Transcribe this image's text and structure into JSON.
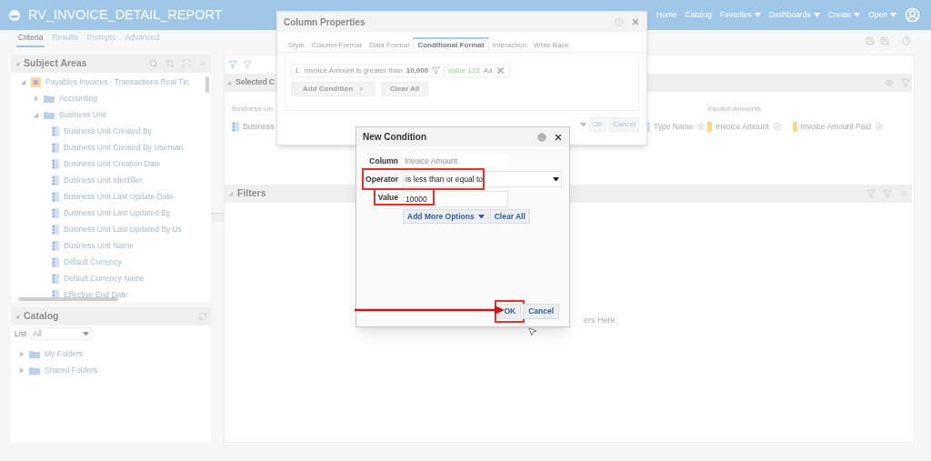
{
  "header": {
    "title": "RV_INVOICE_DETAIL_REPORT",
    "nav": [
      {
        "label": "Home",
        "dropdown": false
      },
      {
        "label": "Catalog",
        "dropdown": false
      },
      {
        "label": "Favorites",
        "dropdown": true
      },
      {
        "label": "Dashboards",
        "dropdown": true
      },
      {
        "label": "Create",
        "dropdown": true
      },
      {
        "label": "Open",
        "dropdown": true
      }
    ]
  },
  "tabs": [
    {
      "label": "Criteria",
      "selected": true
    },
    {
      "label": "Results",
      "selected": false
    },
    {
      "label": "Prompts",
      "selected": false
    },
    {
      "label": "Advanced",
      "selected": false
    }
  ],
  "subject_areas": {
    "title": "Subject Areas",
    "tree": [
      {
        "label": "Payables Invoices - Transactions Real Tin",
        "kind": "subject",
        "expanded": true,
        "children": [
          {
            "label": "Accounting",
            "kind": "folder",
            "expanded": false
          },
          {
            "label": "Business Unit",
            "kind": "folder",
            "expanded": true,
            "children": [
              {
                "label": "Business Unit Created By",
                "kind": "column"
              },
              {
                "label": "Business Unit Created By Usernan",
                "kind": "column"
              },
              {
                "label": "Business Unit Creation Date",
                "kind": "column"
              },
              {
                "label": "Business Unit Identifier",
                "kind": "column"
              },
              {
                "label": "Business Unit Last Update Date",
                "kind": "column"
              },
              {
                "label": "Business Unit Last Updated By",
                "kind": "column"
              },
              {
                "label": "Business Unit Last Updated By Us",
                "kind": "column"
              },
              {
                "label": "Business Unit Name",
                "kind": "column"
              },
              {
                "label": "Default Currency",
                "kind": "column"
              },
              {
                "label": "Default Currency Name",
                "kind": "column"
              },
              {
                "label": "Effective End Date",
                "kind": "column"
              }
            ]
          }
        ]
      }
    ]
  },
  "catalog": {
    "title": "Catalog",
    "list_label": "List",
    "list_value": "All",
    "tree": [
      {
        "label": "My Folders",
        "kind": "folder",
        "expanded": false
      },
      {
        "label": "Shared Folders",
        "kind": "folder",
        "expanded": false
      }
    ]
  },
  "selected_columns": {
    "title": "Selected C",
    "groups": [
      {
        "heading": "Business Un",
        "columns": [
          {
            "label": "Business",
            "kind": "attribute"
          }
        ]
      },
      {
        "columns": [
          {
            "label": "Type Name",
            "kind": "attribute"
          }
        ]
      },
      {
        "heading": "Invoice Amounts",
        "columns": [
          {
            "label": "Invoice Amount",
            "kind": "measure"
          },
          {
            "label": "Invoice Amount Paid",
            "kind": "measure"
          }
        ]
      }
    ]
  },
  "filters": {
    "title": "Filters",
    "drop_hint": "ers Here"
  },
  "column_properties": {
    "title": "Column Properties",
    "tabs": [
      {
        "label": "Style",
        "selected": false
      },
      {
        "label": "Column Format",
        "selected": false
      },
      {
        "label": "Data Format",
        "selected": false
      },
      {
        "label": "Conditional Format",
        "selected": true
      },
      {
        "label": "Interaction",
        "selected": false
      },
      {
        "label": "Write Back",
        "selected": false
      }
    ],
    "conditions": [
      {
        "number": "1.",
        "text": "Invoice Amount is greater than",
        "value": "10,000",
        "format_preview": "Value 123",
        "font_sample": "Aa"
      }
    ],
    "buttons": [
      {
        "label": "Add Condition",
        "kind": "menu"
      },
      {
        "label": "Clear All",
        "kind": "plain"
      }
    ],
    "footer_buttons": [
      "OK",
      "Cancel"
    ]
  },
  "new_condition": {
    "title": "New Condition",
    "fields": [
      {
        "label": "Column",
        "kind": "readonly",
        "value": "Invoice Amount",
        "highlighted": false
      },
      {
        "label": "Operator",
        "kind": "select",
        "value": "is less than or equal to",
        "highlighted": true
      },
      {
        "label": "Value",
        "kind": "input",
        "value": "10000",
        "highlighted": true
      }
    ],
    "option_buttons": [
      {
        "label": "Add More Options",
        "dropdown": true
      },
      {
        "label": "Clear All",
        "dropdown": false
      }
    ],
    "footer_buttons": [
      {
        "label": "OK",
        "highlighted": true
      },
      {
        "label": "Cancel",
        "highlighted": false
      }
    ]
  }
}
